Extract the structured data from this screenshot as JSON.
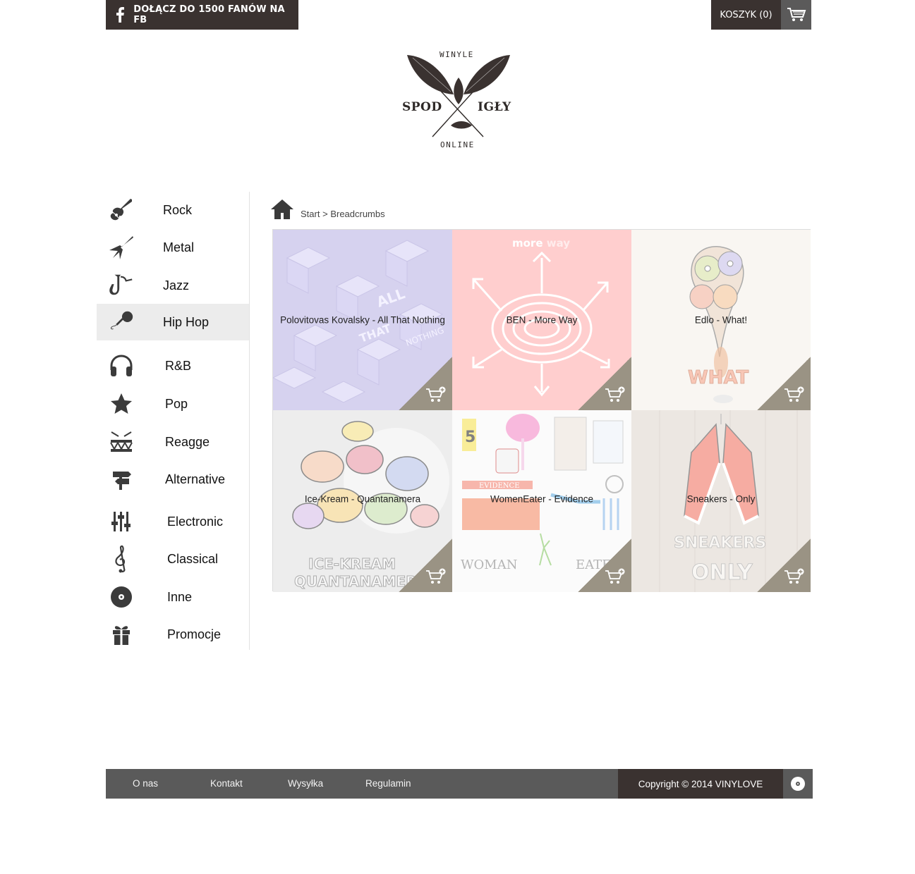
{
  "topbar": {
    "facebook_label": "DOŁĄCZ DO 1500 FANÓW NA FB",
    "cart_label": "KOSZYK (0)"
  },
  "logo": {
    "top": "WINYLE",
    "left": "SPOD",
    "right": "IGŁY",
    "bottom": "ONLINE"
  },
  "sidebar": {
    "active": "Hip Hop",
    "items": [
      {
        "label": "Rock",
        "icon": "electric-guitar-icon"
      },
      {
        "label": "Metal",
        "icon": "flying-v-guitar-icon"
      },
      {
        "label": "Jazz",
        "icon": "saxophone-icon"
      },
      {
        "label": "Hip Hop",
        "icon": "microphone-icon"
      },
      {
        "label": "R&B",
        "icon": "headphones-icon"
      },
      {
        "label": "Pop",
        "icon": "star-icon"
      },
      {
        "label": "Reagge",
        "icon": "drum-icon"
      },
      {
        "label": "Alternative",
        "icon": "signpost-icon"
      },
      {
        "label": "Electronic",
        "icon": "equalizer-icon"
      },
      {
        "label": "Classical",
        "icon": "treble-clef-icon"
      },
      {
        "label": "Inne",
        "icon": "vinyl-disc-icon"
      },
      {
        "label": "Promocje",
        "icon": "gift-icon"
      }
    ]
  },
  "breadcrumb": {
    "start": "Start",
    "separator": ">",
    "current": "Breadcrumbs"
  },
  "products": [
    {
      "title": "Polovitovas Kovalsky - All That Nothing",
      "cover_text": "ALL THAT NOTHING",
      "cover_color": "#c8c4ec"
    },
    {
      "title": "BEN - More Way",
      "cover_text": "more way",
      "cover_color": "#ffb8b8"
    },
    {
      "title": "Edlo - What!",
      "cover_text": "WHAT",
      "cover_color": "#f5efe8"
    },
    {
      "title": "Ice-Kream - Quantanamera",
      "cover_text": "ICE-KREAM QUANTANAMERA",
      "cover_color": "#e4e4e4"
    },
    {
      "title": "WomenEater - Evidence",
      "cover_text": "WOMAN EATER",
      "cover_color": "#f7f7f7"
    },
    {
      "title": "Sneakers - Only",
      "cover_text": "SNEAKERS ONLY",
      "cover_color": "#e3dcd5"
    }
  ],
  "footer": {
    "links": [
      "O nas",
      "Kontakt",
      "Wysyłka",
      "Regulamin"
    ],
    "copyright": "Copyright © 2014 VINYLOVE"
  },
  "colors": {
    "dark_brown": "#3a3230",
    "gray": "#5a5a5a",
    "corner": "#9a9384",
    "active_bg": "#ececec"
  }
}
